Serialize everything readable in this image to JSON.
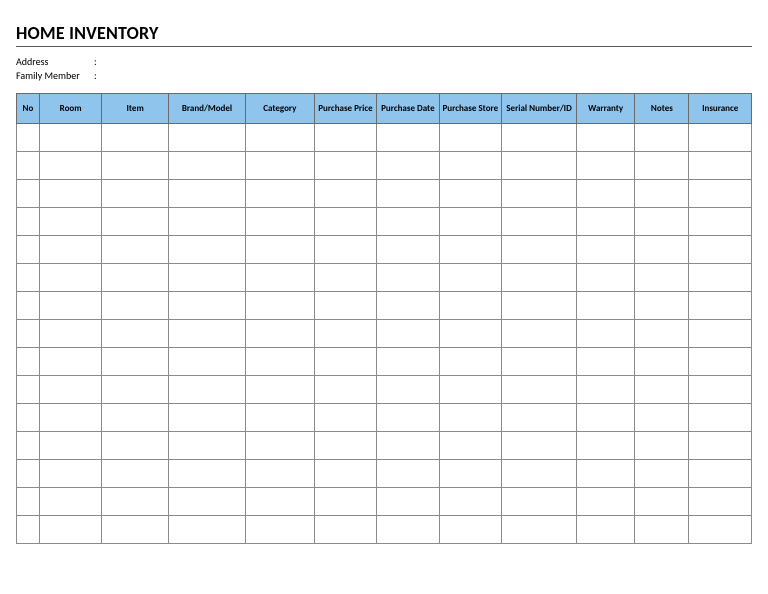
{
  "title": "HOME INVENTORY",
  "meta": {
    "address_label": "Address",
    "address_value": "",
    "family_label": "Family Member",
    "family_value": "",
    "colon": ":"
  },
  "table": {
    "headers": {
      "no": "No",
      "room": "Room",
      "item": "Item",
      "brand": "Brand/Model",
      "category": "Category",
      "pprice": "Purchase Price",
      "pdate": "Purchase Date",
      "pstore": "Purchase Store",
      "serial": "Serial Number/ID",
      "warranty": "Warranty",
      "notes": "Notes",
      "insurance": "Insurance"
    },
    "row_count": 15
  },
  "colors": {
    "header_bg": "#8fc4ed",
    "border": "#6a6a6a"
  }
}
